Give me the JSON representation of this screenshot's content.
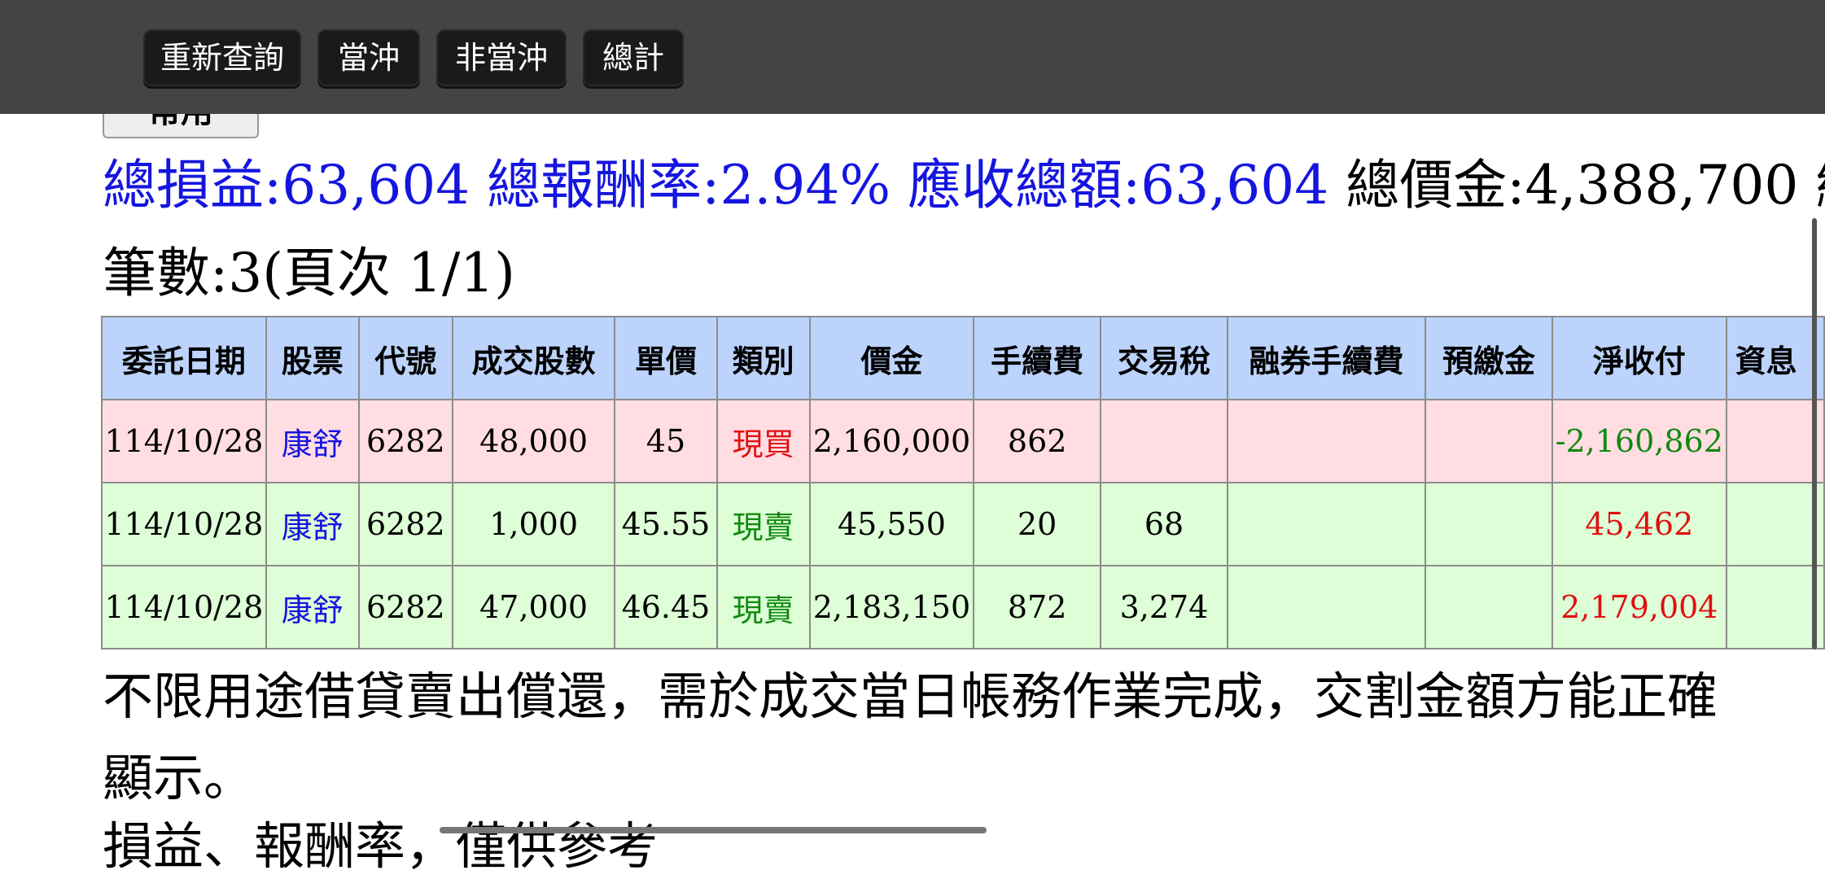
{
  "toolbar": {
    "buttons": [
      "重新查詢",
      "當沖",
      "非當沖",
      "總計"
    ]
  },
  "hidden_button": {
    "label": "常用"
  },
  "summary": {
    "profit_label": "總損益:63,604",
    "return_label": "總報酬率:2.94%",
    "receivable_label": "應收總額:63,604",
    "amount_label": "總價金:4,388,700",
    "cut_label": "總"
  },
  "count_label": "筆數:3(頁次 1/1)",
  "table": {
    "headers": [
      "委託日期",
      "股票",
      "代號",
      "成交股數",
      "單價",
      "類別",
      "價金",
      "手續費",
      "交易稅",
      "融券手續費",
      "預繳金",
      "淨收付",
      "資息"
    ],
    "rows": [
      {
        "date": "114/10/28",
        "stock": "康舒",
        "code": "6282",
        "shares": "48,000",
        "price": "45",
        "kind": "現買",
        "amount": "2,160,000",
        "fee": "862",
        "tax": "",
        "short_fee": "",
        "prepay": "",
        "net": "-2,160,862",
        "interest": ""
      },
      {
        "date": "114/10/28",
        "stock": "康舒",
        "code": "6282",
        "shares": "1,000",
        "price": "45.55",
        "kind": "現賣",
        "amount": "45,550",
        "fee": "20",
        "tax": "68",
        "short_fee": "",
        "prepay": "",
        "net": "45,462",
        "interest": ""
      },
      {
        "date": "114/10/28",
        "stock": "康舒",
        "code": "6282",
        "shares": "47,000",
        "price": "46.45",
        "kind": "現賣",
        "amount": "2,183,150",
        "fee": "872",
        "tax": "3,274",
        "short_fee": "",
        "prepay": "",
        "net": "2,179,004",
        "interest": ""
      }
    ]
  },
  "note": "不限用途借貸賣出償還，需於成交當日帳務作業完成，交割金額方能正確顯示。",
  "note2": "損益、報酬率，僅供參考",
  "colors": {
    "topbar": "#444444",
    "header_bg": "#bcd3fb",
    "buy_row": "#ffdde2",
    "sell_row": "#ddfed6",
    "blue_text": "#1515e0",
    "red_text": "#e01010",
    "green_text": "#0f8a0f"
  }
}
